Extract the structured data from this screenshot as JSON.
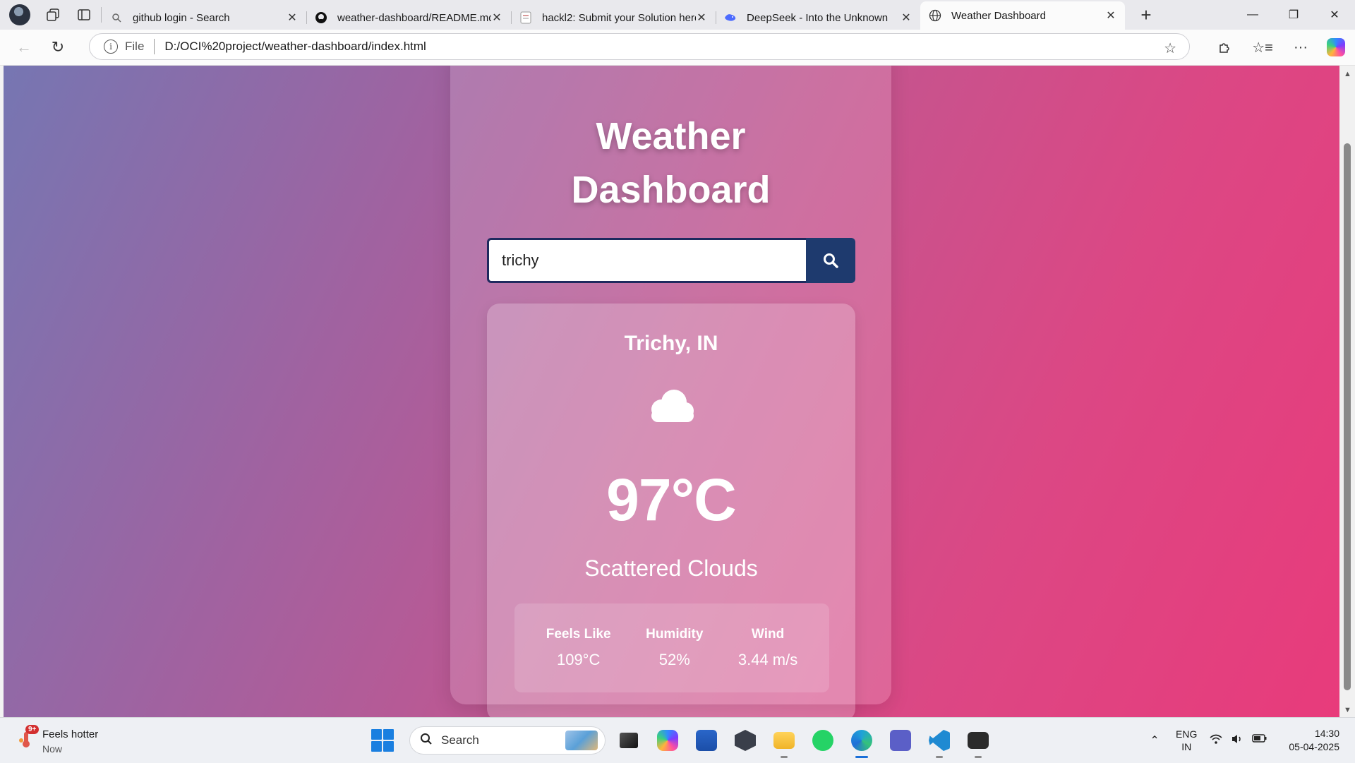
{
  "browser": {
    "tabs": [
      {
        "title": "github login - Search",
        "icon": "search-icon",
        "active": false
      },
      {
        "title": "weather-dashboard/README.md",
        "icon": "github-icon",
        "active": false
      },
      {
        "title": "hackl2: Submit your Solution here",
        "icon": "document-icon",
        "active": false
      },
      {
        "title": "DeepSeek - Into the Unknown",
        "icon": "deepseek-icon",
        "active": false
      },
      {
        "title": "Weather Dashboard",
        "icon": "globe-icon",
        "active": true
      }
    ],
    "address": {
      "scheme": "File",
      "url": "D:/OCI%20project/weather-dashboard/index.html"
    }
  },
  "app": {
    "title_line1": "Weather",
    "title_line2": "Dashboard",
    "search": {
      "value": "trichy"
    },
    "city": "Trichy, IN",
    "weather_icon": "cloud-icon",
    "temperature": "97°C",
    "description": "Scattered Clouds",
    "details": [
      {
        "label": "Feels Like",
        "value": "109°C"
      },
      {
        "label": "Humidity",
        "value": "52%"
      },
      {
        "label": "Wind",
        "value": "3.44 m/s"
      }
    ]
  },
  "taskbar": {
    "widget": {
      "title": "Feels hotter",
      "subtitle": "Now",
      "badge": "9+"
    },
    "search_placeholder": "Search",
    "language": {
      "line1": "ENG",
      "line2": "IN"
    },
    "clock": {
      "time": "14:30",
      "date": "05-04-2025"
    }
  },
  "colors": {
    "search_border": "#1e2a5e",
    "search_button": "#1e3a6e",
    "gradient_start": "#7676b2",
    "gradient_end": "#e83b7b"
  }
}
